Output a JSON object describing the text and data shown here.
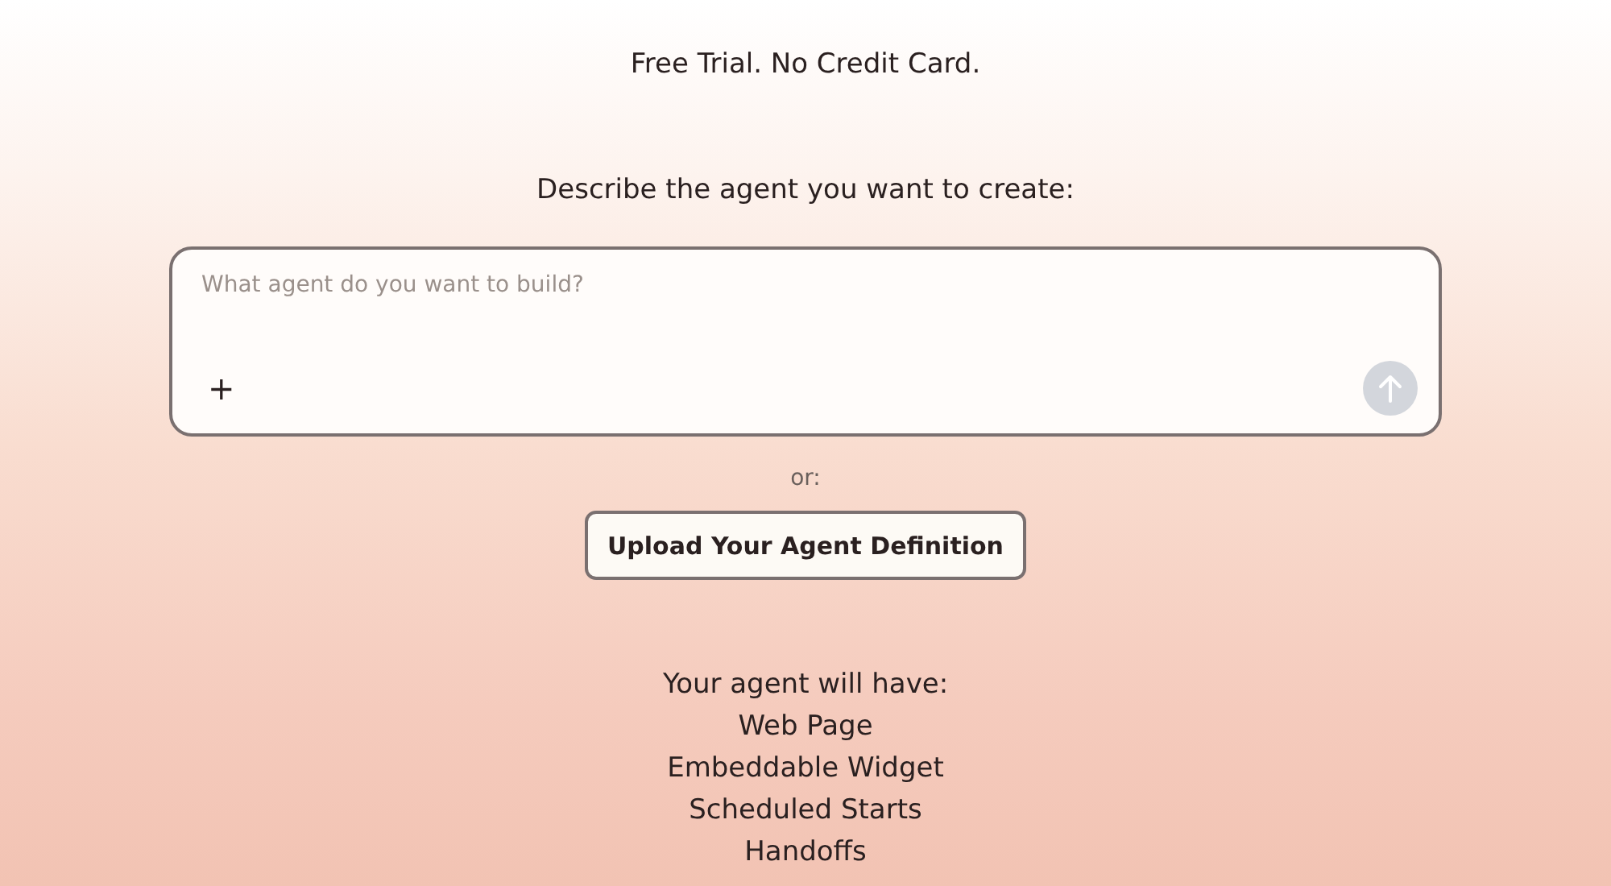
{
  "tagline": "Free Trial. No Credit Card.",
  "prompt_label": "Describe the agent you want to create:",
  "composer": {
    "placeholder": "What agent do you want to build?",
    "add_icon": "+"
  },
  "separator": "or:",
  "upload_button": "Upload Your Agent Definition",
  "features": {
    "heading": "Your agent will have:",
    "items": [
      "Web Page",
      "Embeddable Widget",
      "Scheduled Starts",
      "Handoffs"
    ]
  }
}
